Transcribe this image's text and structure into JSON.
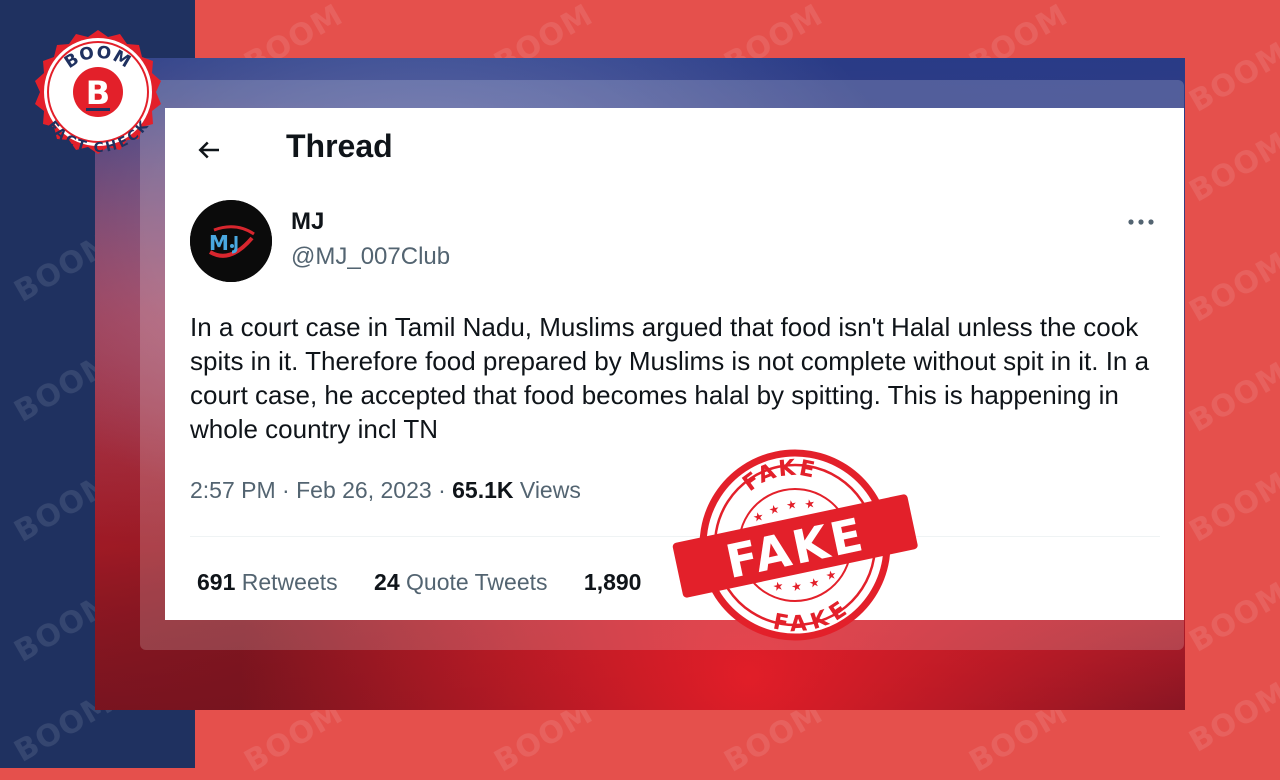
{
  "brand": {
    "logo_top": "BOOM",
    "logo_letter": "B",
    "logo_bottom": "FACT CHECK",
    "watermark": "BOOM"
  },
  "header": {
    "back_icon": "back-arrow-icon",
    "title": "Thread"
  },
  "tweet": {
    "avatar_text": "M",
    "display_name": "MJ",
    "handle": "@MJ_007Club",
    "more_icon": "more-options-icon",
    "text": "In a court case in Tamil Nadu, Muslims argued that food isn't Halal unless the cook spits in it. Therefore food prepared by Muslims is not complete without spit in it. In a court case, he  accepted that food becomes halal by spitting. This is happening in whole country incl TN",
    "time": "2:57 PM",
    "date": "Feb 26, 2023",
    "separator": "·",
    "views_count": "65.1K",
    "views_label": "Views"
  },
  "stats": [
    {
      "count": "691",
      "label": "Retweets"
    },
    {
      "count": "24",
      "label": "Quote Tweets"
    },
    {
      "count": "1,890",
      "label": ""
    }
  ],
  "stamp": {
    "main": "FAKE",
    "top": "FAKE",
    "bottom": "FAKE"
  },
  "colors": {
    "brand_red": "#e5504c",
    "brand_navy": "#1f3160",
    "stamp_red": "#e3202a",
    "text_primary": "#0f1419",
    "text_secondary": "#536471"
  }
}
